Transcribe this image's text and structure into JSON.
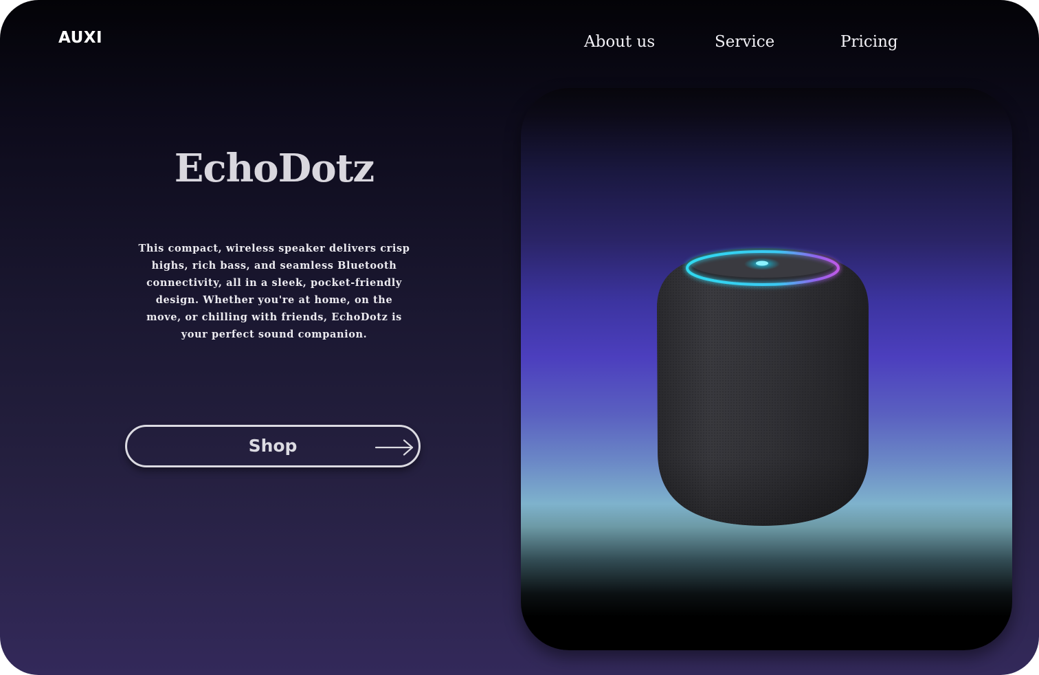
{
  "brand": {
    "logo_text": "AUXI"
  },
  "nav": {
    "items": [
      {
        "label": "About us"
      },
      {
        "label": "Service"
      },
      {
        "label": "Pricing"
      }
    ]
  },
  "hero": {
    "title": "EchoDotz",
    "description": "This compact, wireless speaker delivers crisp highs, rich bass, and seamless Bluetooth connectivity, all in a sleek, pocket-friendly design. Whether you're at home, on the move, or chilling with friends, EchoDotz is your perfect sound companion.",
    "cta_label": "Shop",
    "cta_icon": "arrow-right-icon"
  },
  "product": {
    "image_subject": "smart-speaker",
    "ring_colors": [
      "#2fd9f0",
      "#b54fe8"
    ]
  },
  "colors": {
    "background_top": "#030307",
    "background_bottom": "#33295a",
    "accent_purple": "#4c3fbe",
    "accent_cyan": "#7eb2cc"
  }
}
